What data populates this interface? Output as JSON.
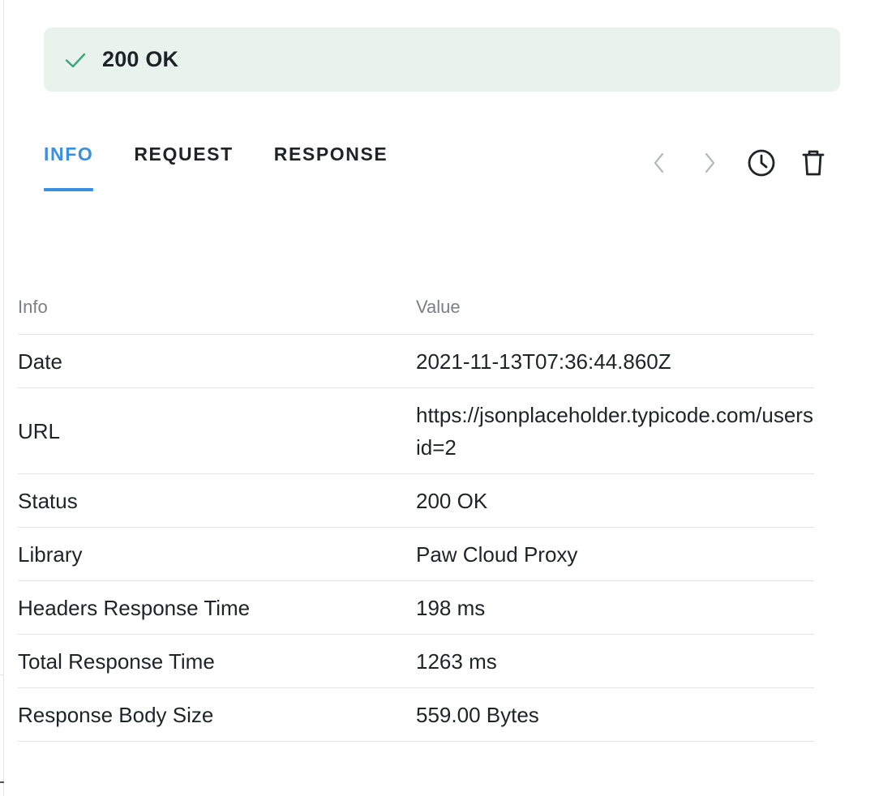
{
  "status": {
    "text": "200 OK",
    "icon": "check-icon",
    "color": "#3aa676",
    "background": "#e8f3ee"
  },
  "tabs": [
    {
      "label": "INFO",
      "active": true
    },
    {
      "label": "REQUEST",
      "active": false
    },
    {
      "label": "RESPONSE",
      "active": false
    }
  ],
  "toolbar": {
    "prev_icon": "chevron-left-icon",
    "next_icon": "chevron-right-icon",
    "history_icon": "clock-icon",
    "delete_icon": "trash-icon"
  },
  "table": {
    "headers": {
      "info": "Info",
      "value": "Value"
    },
    "rows": [
      {
        "info": "Date",
        "value_line1": "2021-11-13T07:36:44.860Z",
        "value_line2": ""
      },
      {
        "info": "URL",
        "value_line1": "https://jsonplaceholder.typicode.com/users",
        "value_line2": "id=2"
      },
      {
        "info": "Status",
        "value_line1": "200 OK",
        "value_line2": ""
      },
      {
        "info": "Library",
        "value_line1": "Paw Cloud Proxy",
        "value_line2": ""
      },
      {
        "info": "Headers Response Time",
        "value_line1": "198 ms",
        "value_line2": ""
      },
      {
        "info": "Total Response Time",
        "value_line1": "1263 ms",
        "value_line2": ""
      },
      {
        "info": "Response Body Size",
        "value_line1": "559.00 Bytes",
        "value_line2": ""
      }
    ]
  },
  "colors": {
    "accent": "#3b8fe0",
    "text": "#1f2328",
    "muted": "#7a7f86",
    "divider": "#e3e4e6"
  }
}
